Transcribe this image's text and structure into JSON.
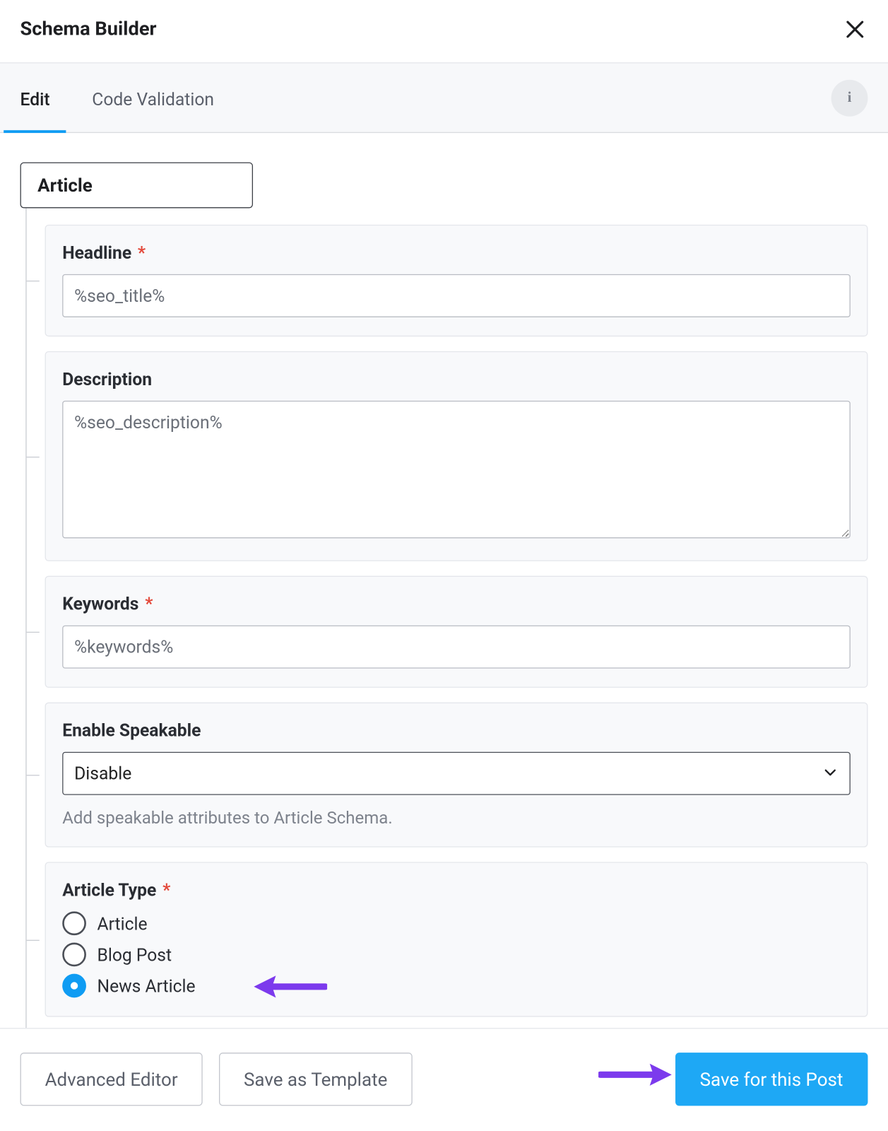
{
  "header": {
    "title": "Schema Builder"
  },
  "tabs": {
    "edit": "Edit",
    "code_validation": "Code Validation"
  },
  "schema": {
    "root_label": "Article",
    "fields": {
      "headline": {
        "label": "Headline",
        "value": "%seo_title%",
        "required": true
      },
      "description": {
        "label": "Description",
        "value": "%seo_description%",
        "required": false
      },
      "keywords": {
        "label": "Keywords",
        "value": "%keywords%",
        "required": true
      },
      "speakable": {
        "label": "Enable Speakable",
        "selected": "Disable",
        "helper": "Add speakable attributes to Article Schema."
      },
      "article_type": {
        "label": "Article Type",
        "required": true,
        "options": {
          "article": "Article",
          "blog_post": "Blog Post",
          "news_article": "News Article"
        },
        "selected": "news_article"
      }
    }
  },
  "footer": {
    "advanced_editor": "Advanced Editor",
    "save_template": "Save as Template",
    "save_post": "Save for this Post"
  }
}
